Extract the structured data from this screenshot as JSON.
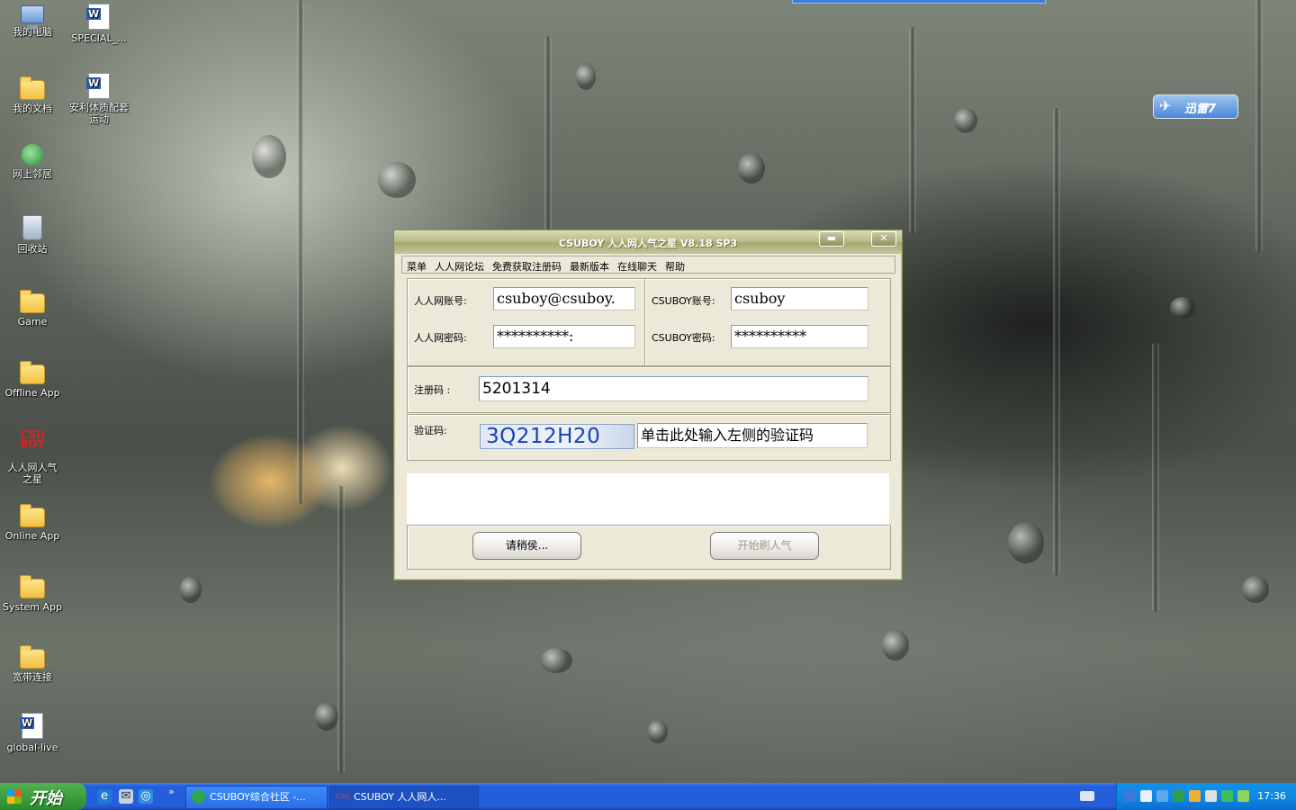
{
  "desktop": {
    "icons": [
      {
        "label": "我的电脑",
        "icon": "computer-icon"
      },
      {
        "label": "SPECIAL_...",
        "icon": "document-icon"
      },
      {
        "label": "我的文档",
        "icon": "documents-folder-icon"
      },
      {
        "label": "安利体质配套运动",
        "icon": "word-document-icon"
      },
      {
        "label": "网上邻居",
        "icon": "network-icon"
      },
      {
        "label": "回收站",
        "icon": "recycle-bin-icon"
      },
      {
        "label": "Game",
        "icon": "folder-icon"
      },
      {
        "label": "Offline App",
        "icon": "folder-icon"
      },
      {
        "label": "人人网人气之星",
        "icon": "csuboy-app-icon",
        "icon_text": "CSU BOY"
      },
      {
        "label": "Online App",
        "icon": "folder-icon"
      },
      {
        "label": "System App",
        "icon": "folder-icon"
      },
      {
        "label": "宽带连接",
        "icon": "folder-icon"
      },
      {
        "label": "global-live",
        "icon": "document-icon"
      }
    ],
    "xunlei_widget": "迅雷7"
  },
  "window": {
    "title": "CSUBOY 人人网人气之星 V8.18 SP3",
    "minimize_label": "▬",
    "close_label": "✕",
    "menu": [
      "菜单",
      "人人网论坛",
      "免费获取注册码",
      "最新版本",
      "在线聊天",
      "帮助"
    ],
    "renren_account_label": "人人网账号:",
    "renren_account_value": "csuboy@csuboy.",
    "renren_password_label": "人人网密码:",
    "renren_password_value": "**********:",
    "csuboy_account_label": "CSUBOY账号:",
    "csuboy_account_value": "csuboy",
    "csuboy_password_label": "CSUBOY密码:",
    "csuboy_password_value": "**********",
    "reg_code_label": "注册码 :",
    "reg_code_value": "5201314",
    "captcha_label": "验证码:",
    "captcha_image_text": "3Q212H20",
    "captcha_input_placeholder": "单击此处输入左侧的验证码",
    "wait_button": "请稍侯...",
    "start_button": "开始刷人气"
  },
  "taskbar": {
    "start_label": "开始",
    "quick_launch": [
      "ie-icon",
      "outlook-icon",
      "browser-icon"
    ],
    "overflow": "»",
    "tasks": [
      {
        "label": "CSUBOY综合社区 -...",
        "active": false
      },
      {
        "label": "CSUBOY 人人网人...",
        "active": true
      }
    ],
    "clock": "17:36"
  },
  "colors": {
    "taskbar_blue": "#245edb",
    "start_green": "#3c9f3c",
    "window_title_olive": "#a5aa73",
    "captcha_blue": "#1a3fb0"
  }
}
